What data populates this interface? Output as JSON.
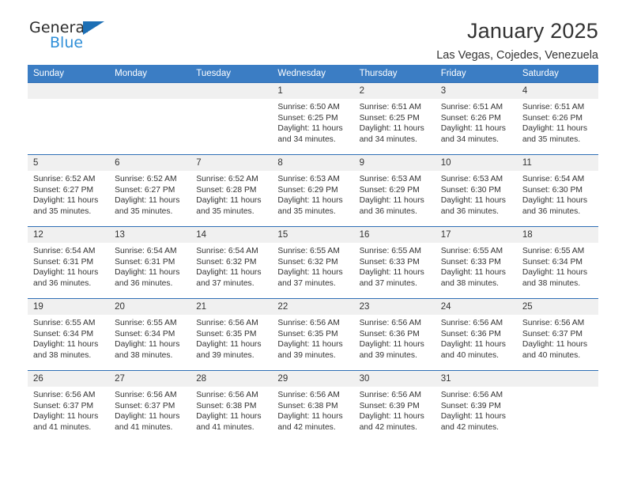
{
  "brand": {
    "name_part1": "General",
    "name_part2": "Blue",
    "logo_icon": "triangle-icon",
    "accent_color": "#2f8fd8",
    "triangle_color": "#1c6fb5"
  },
  "header": {
    "title": "January 2025",
    "subtitle": "Las Vegas, Cojedes, Venezuela"
  },
  "calendar": {
    "header_bg": "#3b7dc4",
    "daynum_bg": "#f0f0f0",
    "row_border_color": "#2f6fb5",
    "weekdays": [
      "Sunday",
      "Monday",
      "Tuesday",
      "Wednesday",
      "Thursday",
      "Friday",
      "Saturday"
    ],
    "weeks": [
      [
        {
          "day": "",
          "lines": []
        },
        {
          "day": "",
          "lines": []
        },
        {
          "day": "",
          "lines": []
        },
        {
          "day": "1",
          "lines": [
            "Sunrise: 6:50 AM",
            "Sunset: 6:25 PM",
            "Daylight: 11 hours",
            "and 34 minutes."
          ]
        },
        {
          "day": "2",
          "lines": [
            "Sunrise: 6:51 AM",
            "Sunset: 6:25 PM",
            "Daylight: 11 hours",
            "and 34 minutes."
          ]
        },
        {
          "day": "3",
          "lines": [
            "Sunrise: 6:51 AM",
            "Sunset: 6:26 PM",
            "Daylight: 11 hours",
            "and 34 minutes."
          ]
        },
        {
          "day": "4",
          "lines": [
            "Sunrise: 6:51 AM",
            "Sunset: 6:26 PM",
            "Daylight: 11 hours",
            "and 35 minutes."
          ]
        }
      ],
      [
        {
          "day": "5",
          "lines": [
            "Sunrise: 6:52 AM",
            "Sunset: 6:27 PM",
            "Daylight: 11 hours",
            "and 35 minutes."
          ]
        },
        {
          "day": "6",
          "lines": [
            "Sunrise: 6:52 AM",
            "Sunset: 6:27 PM",
            "Daylight: 11 hours",
            "and 35 minutes."
          ]
        },
        {
          "day": "7",
          "lines": [
            "Sunrise: 6:52 AM",
            "Sunset: 6:28 PM",
            "Daylight: 11 hours",
            "and 35 minutes."
          ]
        },
        {
          "day": "8",
          "lines": [
            "Sunrise: 6:53 AM",
            "Sunset: 6:29 PM",
            "Daylight: 11 hours",
            "and 35 minutes."
          ]
        },
        {
          "day": "9",
          "lines": [
            "Sunrise: 6:53 AM",
            "Sunset: 6:29 PM",
            "Daylight: 11 hours",
            "and 36 minutes."
          ]
        },
        {
          "day": "10",
          "lines": [
            "Sunrise: 6:53 AM",
            "Sunset: 6:30 PM",
            "Daylight: 11 hours",
            "and 36 minutes."
          ]
        },
        {
          "day": "11",
          "lines": [
            "Sunrise: 6:54 AM",
            "Sunset: 6:30 PM",
            "Daylight: 11 hours",
            "and 36 minutes."
          ]
        }
      ],
      [
        {
          "day": "12",
          "lines": [
            "Sunrise: 6:54 AM",
            "Sunset: 6:31 PM",
            "Daylight: 11 hours",
            "and 36 minutes."
          ]
        },
        {
          "day": "13",
          "lines": [
            "Sunrise: 6:54 AM",
            "Sunset: 6:31 PM",
            "Daylight: 11 hours",
            "and 36 minutes."
          ]
        },
        {
          "day": "14",
          "lines": [
            "Sunrise: 6:54 AM",
            "Sunset: 6:32 PM",
            "Daylight: 11 hours",
            "and 37 minutes."
          ]
        },
        {
          "day": "15",
          "lines": [
            "Sunrise: 6:55 AM",
            "Sunset: 6:32 PM",
            "Daylight: 11 hours",
            "and 37 minutes."
          ]
        },
        {
          "day": "16",
          "lines": [
            "Sunrise: 6:55 AM",
            "Sunset: 6:33 PM",
            "Daylight: 11 hours",
            "and 37 minutes."
          ]
        },
        {
          "day": "17",
          "lines": [
            "Sunrise: 6:55 AM",
            "Sunset: 6:33 PM",
            "Daylight: 11 hours",
            "and 38 minutes."
          ]
        },
        {
          "day": "18",
          "lines": [
            "Sunrise: 6:55 AM",
            "Sunset: 6:34 PM",
            "Daylight: 11 hours",
            "and 38 minutes."
          ]
        }
      ],
      [
        {
          "day": "19",
          "lines": [
            "Sunrise: 6:55 AM",
            "Sunset: 6:34 PM",
            "Daylight: 11 hours",
            "and 38 minutes."
          ]
        },
        {
          "day": "20",
          "lines": [
            "Sunrise: 6:55 AM",
            "Sunset: 6:34 PM",
            "Daylight: 11 hours",
            "and 38 minutes."
          ]
        },
        {
          "day": "21",
          "lines": [
            "Sunrise: 6:56 AM",
            "Sunset: 6:35 PM",
            "Daylight: 11 hours",
            "and 39 minutes."
          ]
        },
        {
          "day": "22",
          "lines": [
            "Sunrise: 6:56 AM",
            "Sunset: 6:35 PM",
            "Daylight: 11 hours",
            "and 39 minutes."
          ]
        },
        {
          "day": "23",
          "lines": [
            "Sunrise: 6:56 AM",
            "Sunset: 6:36 PM",
            "Daylight: 11 hours",
            "and 39 minutes."
          ]
        },
        {
          "day": "24",
          "lines": [
            "Sunrise: 6:56 AM",
            "Sunset: 6:36 PM",
            "Daylight: 11 hours",
            "and 40 minutes."
          ]
        },
        {
          "day": "25",
          "lines": [
            "Sunrise: 6:56 AM",
            "Sunset: 6:37 PM",
            "Daylight: 11 hours",
            "and 40 minutes."
          ]
        }
      ],
      [
        {
          "day": "26",
          "lines": [
            "Sunrise: 6:56 AM",
            "Sunset: 6:37 PM",
            "Daylight: 11 hours",
            "and 41 minutes."
          ]
        },
        {
          "day": "27",
          "lines": [
            "Sunrise: 6:56 AM",
            "Sunset: 6:37 PM",
            "Daylight: 11 hours",
            "and 41 minutes."
          ]
        },
        {
          "day": "28",
          "lines": [
            "Sunrise: 6:56 AM",
            "Sunset: 6:38 PM",
            "Daylight: 11 hours",
            "and 41 minutes."
          ]
        },
        {
          "day": "29",
          "lines": [
            "Sunrise: 6:56 AM",
            "Sunset: 6:38 PM",
            "Daylight: 11 hours",
            "and 42 minutes."
          ]
        },
        {
          "day": "30",
          "lines": [
            "Sunrise: 6:56 AM",
            "Sunset: 6:39 PM",
            "Daylight: 11 hours",
            "and 42 minutes."
          ]
        },
        {
          "day": "31",
          "lines": [
            "Sunrise: 6:56 AM",
            "Sunset: 6:39 PM",
            "Daylight: 11 hours",
            "and 42 minutes."
          ]
        },
        {
          "day": "",
          "lines": []
        }
      ]
    ]
  }
}
